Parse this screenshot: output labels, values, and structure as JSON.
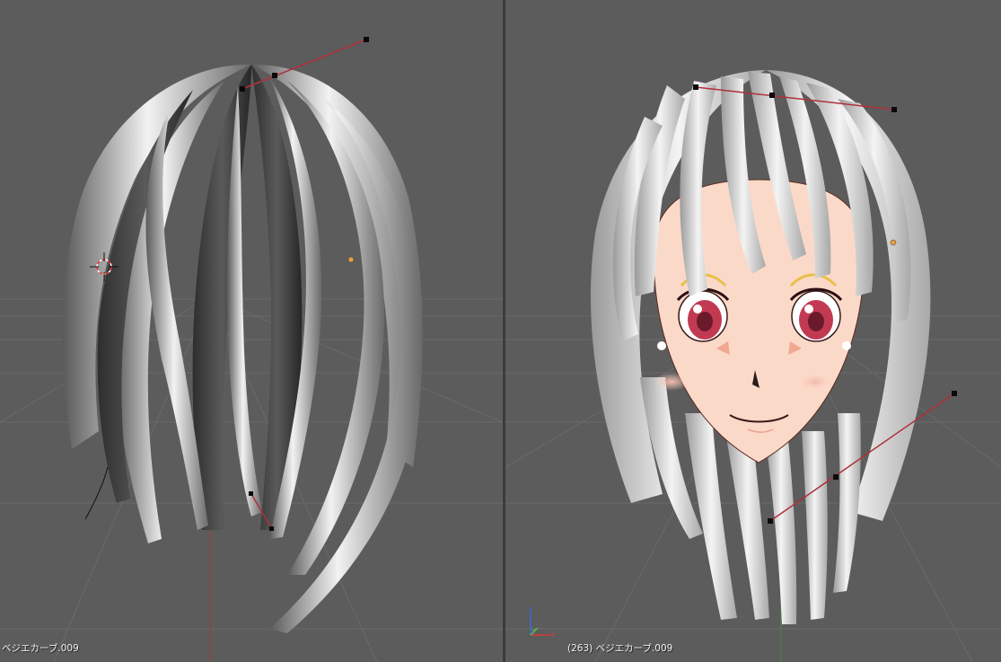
{
  "viewport_left": {
    "object_label": "ベジエカーブ.009"
  },
  "viewport_right": {
    "object_label": "(263) ベジエカーブ.009",
    "axes": {
      "z": "z",
      "y": "y",
      "x": "x"
    }
  },
  "colors": {
    "viewport_bg": "#5c5c5c",
    "grid_line": "#6a6a6a",
    "curve_handle": "#b0303c",
    "control_point": "#0a0a0a",
    "origin_point": "#e8a040",
    "hair_highlight": "#e6e6e6",
    "skin": "#fbd9c8",
    "eye": "#c23a52"
  }
}
